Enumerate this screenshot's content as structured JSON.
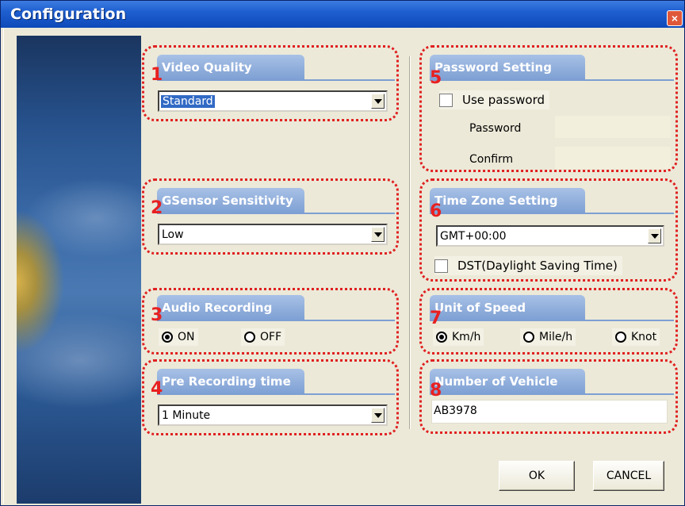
{
  "window": {
    "title": "Configuration",
    "close_glyph": "×"
  },
  "video_quality": {
    "number": "1",
    "title": "Video Quality",
    "value": "Standard"
  },
  "gsensor": {
    "number": "2",
    "title": "GSensor Sensitivity",
    "value": "Low"
  },
  "audio": {
    "number": "3",
    "title": "Audio Recording",
    "options": [
      "ON",
      "OFF"
    ],
    "selected": "ON"
  },
  "pre_recording": {
    "number": "4",
    "title": "Pre Recording time",
    "value": "1 Minute"
  },
  "password": {
    "number": "5",
    "title": "Password Setting",
    "use_label": "Use password",
    "use_checked": false,
    "password_label": "Password",
    "confirm_label": "Confirm",
    "password_value": "",
    "confirm_value": ""
  },
  "timezone": {
    "number": "6",
    "title": "Time Zone Setting",
    "value": "GMT+00:00",
    "dst_label": "DST(Daylight Saving Time)",
    "dst_checked": false
  },
  "speed_unit": {
    "number": "7",
    "title": "Unit of Speed",
    "options": [
      "Km/h",
      "Mile/h",
      "Knot"
    ],
    "selected": "Km/h"
  },
  "vehicle": {
    "number": "8",
    "title": "Number of Vehicle",
    "value": "AB3978"
  },
  "buttons": {
    "ok": "OK",
    "cancel": "CANCEL"
  },
  "colors": {
    "group_outline": "#e02020",
    "tab_blue": "#7d9fd3",
    "title_blue": "#1e5fd0",
    "selection_blue": "#316ac5"
  },
  "icons": {
    "close": "close-icon",
    "dropdown": "chevron-down-icon",
    "radio": "radio-icon",
    "checkbox": "checkbox-icon"
  }
}
